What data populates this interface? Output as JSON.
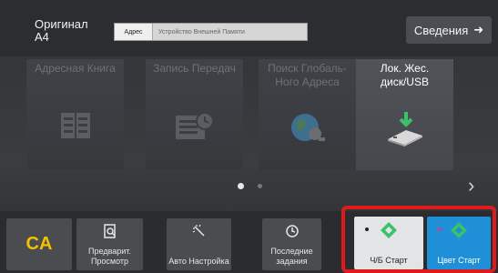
{
  "header": {
    "original_label": "Оригинал",
    "original_size": "A4",
    "address_label": "Адрес",
    "address_placeholder": "Устройство Внешней Памяти",
    "info_button": "Сведения"
  },
  "tiles": [
    {
      "label": "Адресная Книга",
      "enabled": false,
      "icon": "address-book-icon"
    },
    {
      "label": "Запись Передач",
      "enabled": false,
      "icon": "transmission-log-icon"
    },
    {
      "label": "Поиск Глобаль- Ного Адреса",
      "enabled": false,
      "icon": "global-search-icon"
    },
    {
      "label": "Лок. Жес. диск/USB",
      "enabled": true,
      "icon": "usb-download-icon"
    }
  ],
  "pager": {
    "current": 1,
    "total": 2
  },
  "bottom": {
    "ca": "CA",
    "preview": "Предварит. Просмотр",
    "auto": "Авто Настройка",
    "recent": "Последние задания",
    "bw_start": "Ч/Б Старт",
    "color_start": "Цвет Старт"
  },
  "colors": {
    "accent_yellow": "#f2c200",
    "start_blue": "#1f8fd8",
    "start_green": "#3cc06a",
    "highlight_red": "#e01a1a"
  }
}
